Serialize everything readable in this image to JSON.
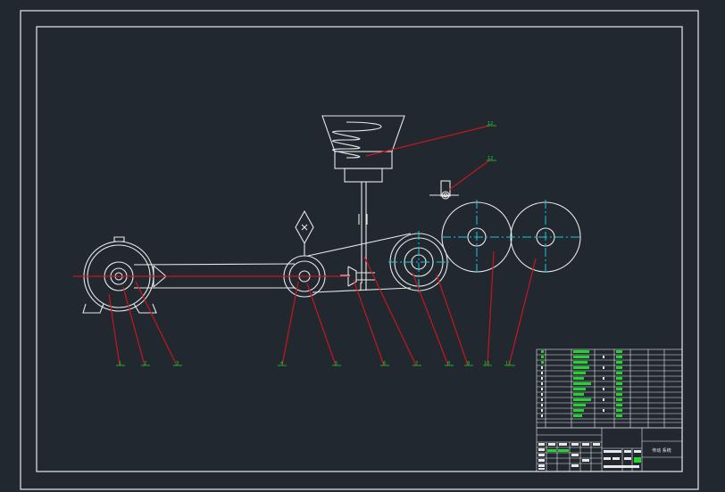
{
  "drawing": {
    "balloons": [
      "1",
      "2",
      "3",
      "4",
      "5",
      "6",
      "7",
      "8",
      "9",
      "10",
      "11",
      "12"
    ],
    "title_block": {
      "drawing_title": "传动 系统"
    }
  },
  "colors": {
    "background": "#212830",
    "line": "#e8e8e8",
    "leader": "#c8161d",
    "centerline": "#18c8d8",
    "label": "#20d030"
  }
}
